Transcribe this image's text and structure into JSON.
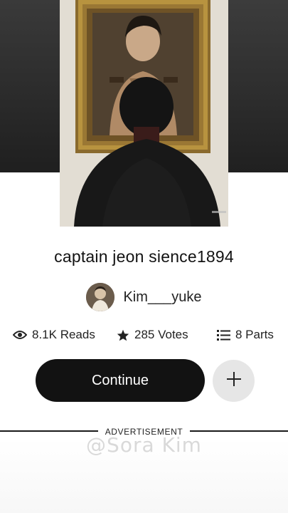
{
  "story": {
    "title": "captain jeon sience1894",
    "author": "Kim___yuke"
  },
  "stats": {
    "reads": "8.1K Reads",
    "votes": "285 Votes",
    "parts": "8 Parts",
    "reads_icon": "eye-icon",
    "votes_icon": "star-icon",
    "parts_icon": "list-icon"
  },
  "actions": {
    "continue_label": "Continue",
    "add_icon": "plus-icon"
  },
  "ad": {
    "label": "ADVERTISEMENT"
  },
  "overlay": {
    "watermark": "@Sora Kim"
  },
  "colors": {
    "primary_button": "#121212",
    "secondary_button": "#e6e6e6",
    "text": "#121212"
  }
}
